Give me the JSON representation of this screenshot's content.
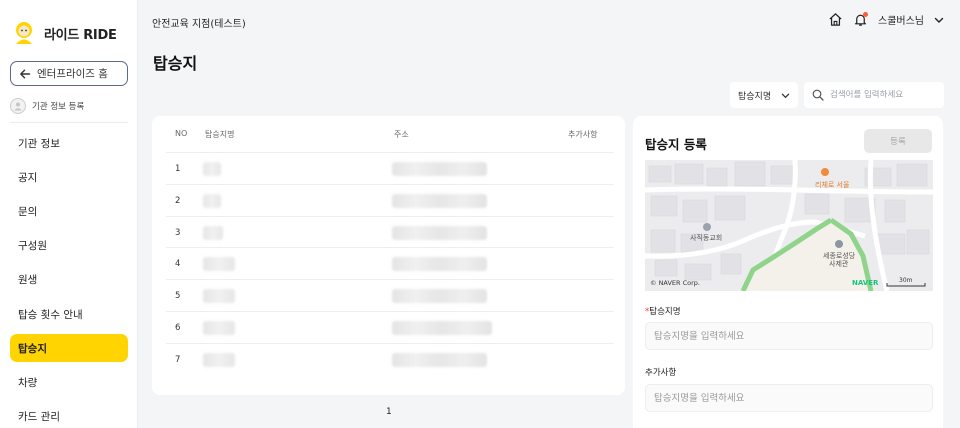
{
  "brand": {
    "name": "라이드 RIDE"
  },
  "sidebar": {
    "home_button": "엔터프라이즈 홈",
    "register_org": "기관 정보 등록",
    "items": [
      {
        "label": "기관 정보"
      },
      {
        "label": "공지"
      },
      {
        "label": "문의"
      },
      {
        "label": "구성원"
      },
      {
        "label": "원생"
      },
      {
        "label": "탑승 횟수 안내"
      },
      {
        "label": "탑승지",
        "active": true
      },
      {
        "label": "차량"
      },
      {
        "label": "카드 관리"
      }
    ]
  },
  "header": {
    "org_name": "안전교육 지점(테스트)",
    "user_name": "스쿨버스님",
    "icons": [
      "home-icon",
      "bell-icon",
      "chevron-down-icon"
    ]
  },
  "page": {
    "title": "탑승지"
  },
  "filter": {
    "select_value": "탑승지명",
    "search_placeholder": "검색어를 입력하세요"
  },
  "table": {
    "columns": {
      "no": "NO",
      "name": "탑승지명",
      "address": "주소",
      "extra": "추가사항"
    },
    "rows": [
      {
        "no": "1"
      },
      {
        "no": "2"
      },
      {
        "no": "3"
      },
      {
        "no": "4"
      },
      {
        "no": "5"
      },
      {
        "no": "6"
      },
      {
        "no": "7"
      }
    ],
    "pagination": {
      "current": "1"
    }
  },
  "register_panel": {
    "title": "탑승지 등록",
    "submit_label": "등록",
    "map": {
      "labels": {
        "poi1": "리체로 서울",
        "poi2": "사직동교회",
        "poi3a": "세종로성당",
        "poi3b": "사제관",
        "credit": "© NAVER Corp.",
        "logo": "NAVER",
        "scale": "30m"
      }
    },
    "name_field": {
      "label": "탑승지명",
      "required_mark": "*",
      "placeholder": "탑승지명을 입력하세요"
    },
    "extra_field": {
      "label": "추가사항",
      "placeholder": "탑승지명을 입력하세요"
    }
  },
  "colors": {
    "accent": "#ffd400",
    "map_green": "#8fd48a"
  }
}
